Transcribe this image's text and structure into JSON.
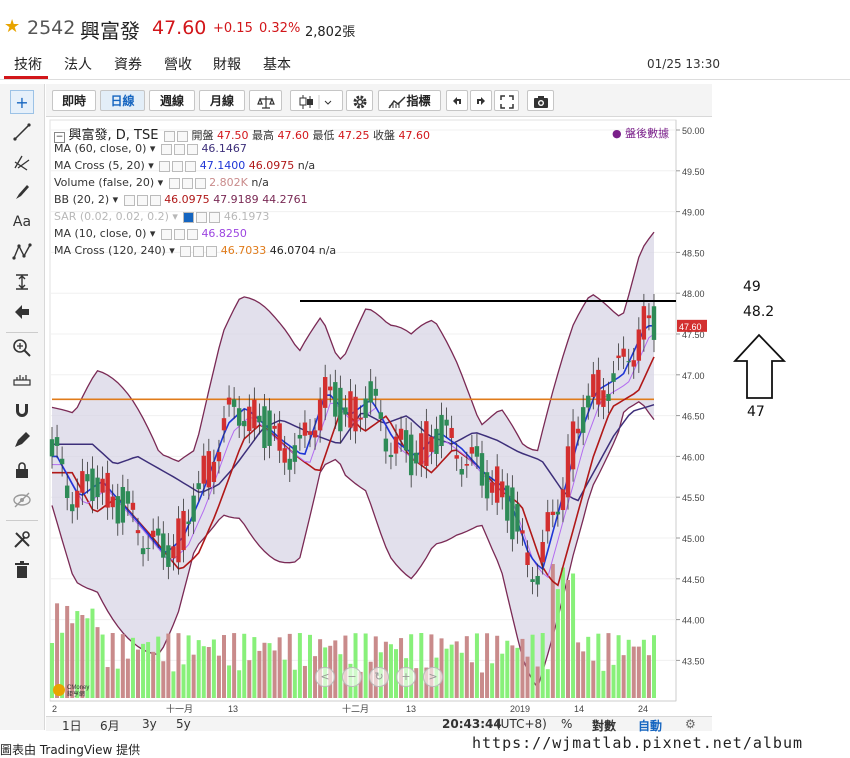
{
  "header": {
    "star_icon": "star-icon",
    "code": "2542",
    "name": "興富發",
    "price": "47.60",
    "change": "+0.15",
    "change_pct": "0.32%",
    "volume": "2,802張"
  },
  "tabs": [
    "技術",
    "法人",
    "資券",
    "營收",
    "財報",
    "基本"
  ],
  "active_tab": "技術",
  "datetime": "01/25 13:30",
  "toolbar": {
    "intraday": "即時",
    "daily": "日線",
    "weekly": "週線",
    "monthly": "月線",
    "indicators": "指標"
  },
  "legend": {
    "main": {
      "title": "興富發, D, TSE",
      "open_label": "開盤",
      "open": "47.50",
      "high_label": "最高",
      "high": "47.60",
      "low_label": "最低",
      "low": "47.25",
      "close_label": "收盤",
      "close": "47.60"
    },
    "after_hours": "盤後數據",
    "rows": [
      {
        "label": "MA (60, close, 0)",
        "v1": "46.1467",
        "v2": "",
        "v3": ""
      },
      {
        "label": "MA Cross (5, 20)",
        "v1": "47.1400",
        "v2": "46.0975",
        "v3": "n/a"
      },
      {
        "label": "Volume (false, 20)",
        "v1": "2.802K",
        "v2": "n/a",
        "v3": ""
      },
      {
        "label": "BB (20, 2)",
        "v1": "46.0975",
        "v2": "47.9189",
        "v3": "44.2761"
      },
      {
        "label": "SAR (0.02, 0.02, 0.2)",
        "v1": "46.1973",
        "v2": "",
        "v3": ""
      },
      {
        "label": "MA (10, close, 0)",
        "v1": "46.8250",
        "v2": "",
        "v3": ""
      },
      {
        "label": "MA Cross (120, 240)",
        "v1": "46.7033",
        "v2": "46.0704",
        "v3": "n/a"
      }
    ]
  },
  "price_axis": [
    "50.00",
    "49.50",
    "49.00",
    "48.50",
    "48.00",
    "47.50",
    "47.00",
    "46.50",
    "46.00",
    "45.50",
    "45.00",
    "44.50",
    "44.00",
    "43.50"
  ],
  "price_tag": "47.60",
  "time_axis": [
    "2",
    "十一月",
    "13",
    "十二月",
    "13",
    "2019",
    "14",
    "24"
  ],
  "bottom": {
    "ranges": [
      "1日",
      "6月",
      "3y",
      "5y"
    ],
    "time": "20:43:44",
    "tz": "(UTC+8)",
    "pct": "%",
    "log": "對數",
    "auto": "自動"
  },
  "credit": "圖表由 TradingView 提供",
  "watermark": "https://wjmatlab.pixnet.net/album",
  "logo_text": "GMoney 鉅亨網",
  "annotation": {
    "a": "49",
    "b": "48.2",
    "c": "47"
  },
  "colors": {
    "up": "#d32f2f",
    "down": "#2e8b57",
    "vol_up": "#c98b8b",
    "vol_down": "#88f07a",
    "bb_fill": "#d8d6e6",
    "ma5": "#1f36d6",
    "ma20": "#b01818",
    "ma60": "#3d2f7a",
    "ma120": "#e07b1a",
    "ma10": "#b36cf0"
  }
}
